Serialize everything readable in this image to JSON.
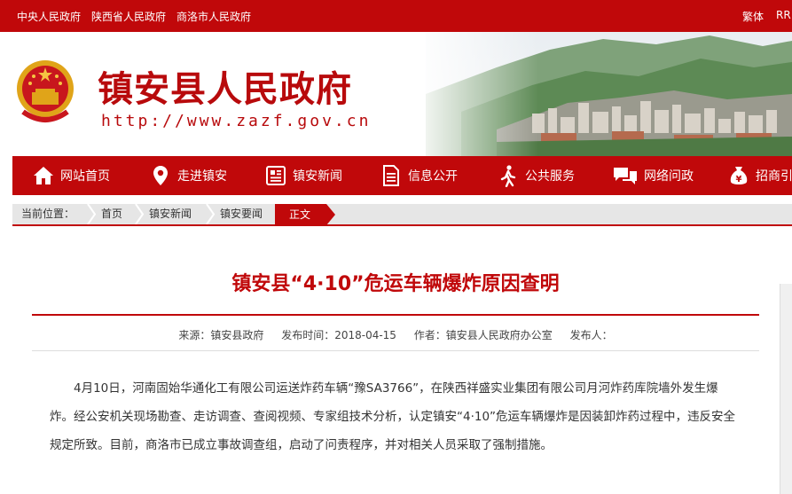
{
  "topbar": {
    "links": [
      "中央人民政府",
      "陕西省人民政府",
      "商洛市人民政府"
    ],
    "lang_trad": "繁体",
    "lang_other": "RR"
  },
  "header": {
    "site_name": "镇安县人民政府",
    "site_url": "http://www.zazf.gov.cn"
  },
  "nav": {
    "items": [
      {
        "label": "网站首页",
        "icon": "home-icon"
      },
      {
        "label": "走进镇安",
        "icon": "location-pin-icon"
      },
      {
        "label": "镇安新闻",
        "icon": "news-icon"
      },
      {
        "label": "信息公开",
        "icon": "document-icon"
      },
      {
        "label": "公共服务",
        "icon": "person-walking-icon"
      },
      {
        "label": "网络问政",
        "icon": "chat-bubbles-icon"
      },
      {
        "label": "招商引",
        "icon": "money-bag-icon"
      }
    ]
  },
  "breadcrumb": {
    "prefix": "当前位置：",
    "items": [
      "首页",
      "镇安新闻",
      "镇安要闻"
    ],
    "current": "正文"
  },
  "article": {
    "title": "镇安县“4·10”危运车辆爆炸原因查明",
    "source": "来源：镇安县政府",
    "published": "发布时间：2018-04-15",
    "author": "作者：镇安县人民政府办公室",
    "publisher": "发布人：",
    "paragraph": "4月10日，河南固始华通化工有限公司运送炸药车辆“豫SA3766”，在陕西祥盛实业集团有限公司月河炸药库院墙外发生爆炸。经公安机关现场勘查、走访调查、查阅视频、专家组技术分析，认定镇安“4·10”危运车辆爆炸是因装卸炸药过程中，违反安全规定所致。目前，商洛市已成立事故调查组，启动了问责程序，并对相关人员采取了强制措施。"
  },
  "colors": {
    "brand_red": "#c0080a"
  }
}
